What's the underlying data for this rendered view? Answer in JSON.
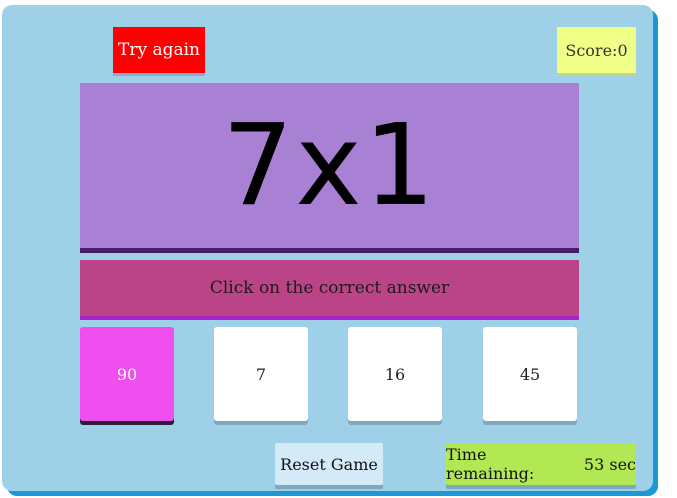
{
  "header": {
    "try_again_label": "Try again",
    "score_label": "Score:",
    "score_value": "0"
  },
  "question": {
    "text": "7x1"
  },
  "instruction": {
    "text": "Click on the correct answer"
  },
  "choices": [
    {
      "label": "90",
      "selected": true
    },
    {
      "label": "7",
      "selected": false
    },
    {
      "label": "16",
      "selected": false
    },
    {
      "label": "45",
      "selected": false
    }
  ],
  "footer": {
    "reset_label": "Reset Game",
    "time_label": "Time remaining: ",
    "time_value": "53",
    "time_unit": " sec"
  },
  "colors": {
    "container_bg": "#9ed1e8",
    "container_shadow": "#1a99d6",
    "try_again_bg": "#ff0000",
    "score_bg": "#f0ff88",
    "question_bg": "#a880d4",
    "instruction_bg": "#bb4488",
    "selected_choice_bg": "#ee4fee",
    "timer_bg": "#b3e855",
    "reset_bg": "#d4eaf7"
  }
}
